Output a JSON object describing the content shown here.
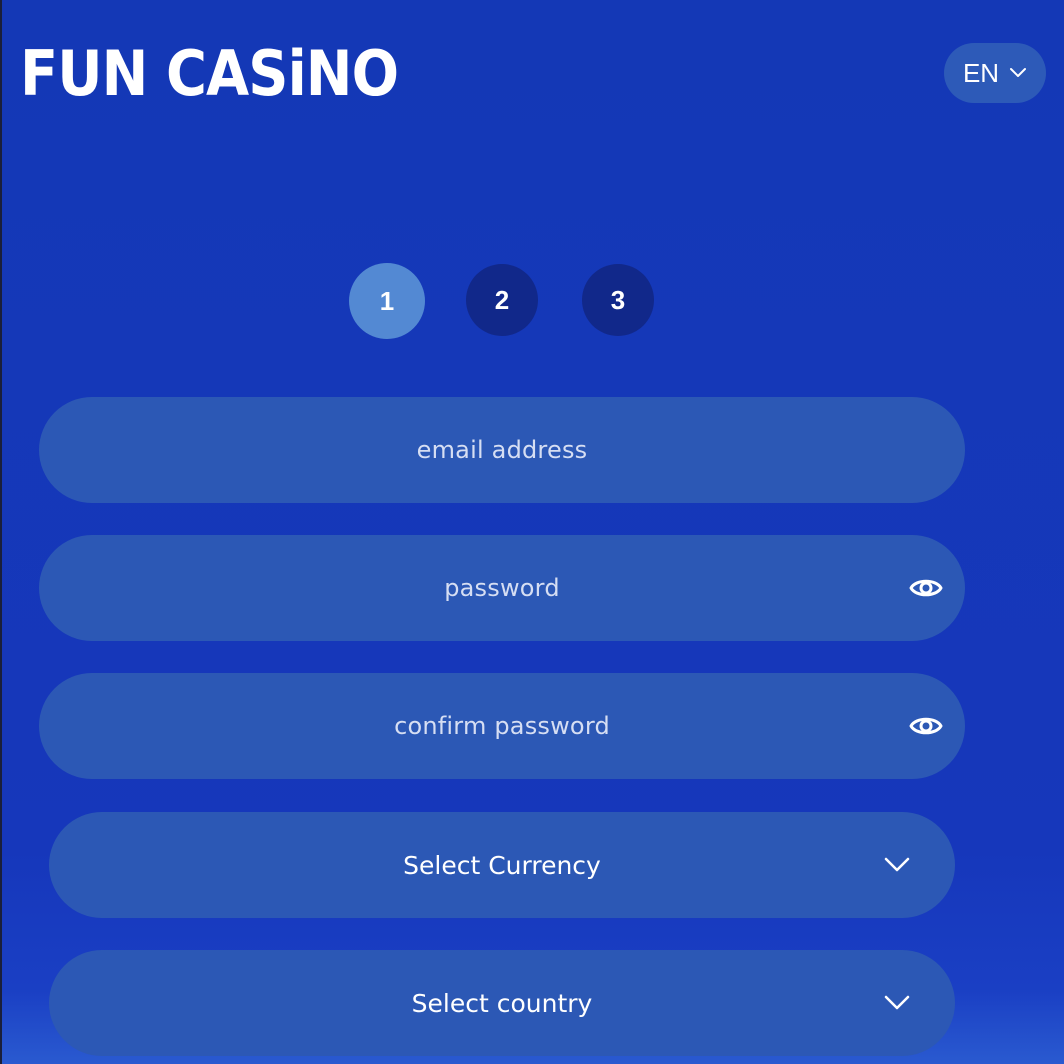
{
  "header": {
    "logo": "FUN CASiNO",
    "language": {
      "selected": "EN",
      "icon": "chevron-down-icon"
    }
  },
  "stepper": {
    "steps": [
      {
        "label": "1",
        "active": true
      },
      {
        "label": "2",
        "active": false
      },
      {
        "label": "3",
        "active": false
      }
    ],
    "current": 1
  },
  "form": {
    "email": {
      "placeholder": "email address"
    },
    "password": {
      "placeholder": "password",
      "icon": "eye-icon"
    },
    "confirm_password": {
      "placeholder": "confirm password",
      "icon": "eye-icon"
    },
    "currency": {
      "selected": "Select Currency",
      "icon": "chevron-down-icon"
    },
    "country": {
      "selected": "Select country",
      "icon": "chevron-down-icon"
    }
  },
  "colors": {
    "background": "#1438b6",
    "field": "#2c58b5",
    "step_active": "#5389d3",
    "step_inactive": "#11288a",
    "text": "#ffffff"
  }
}
